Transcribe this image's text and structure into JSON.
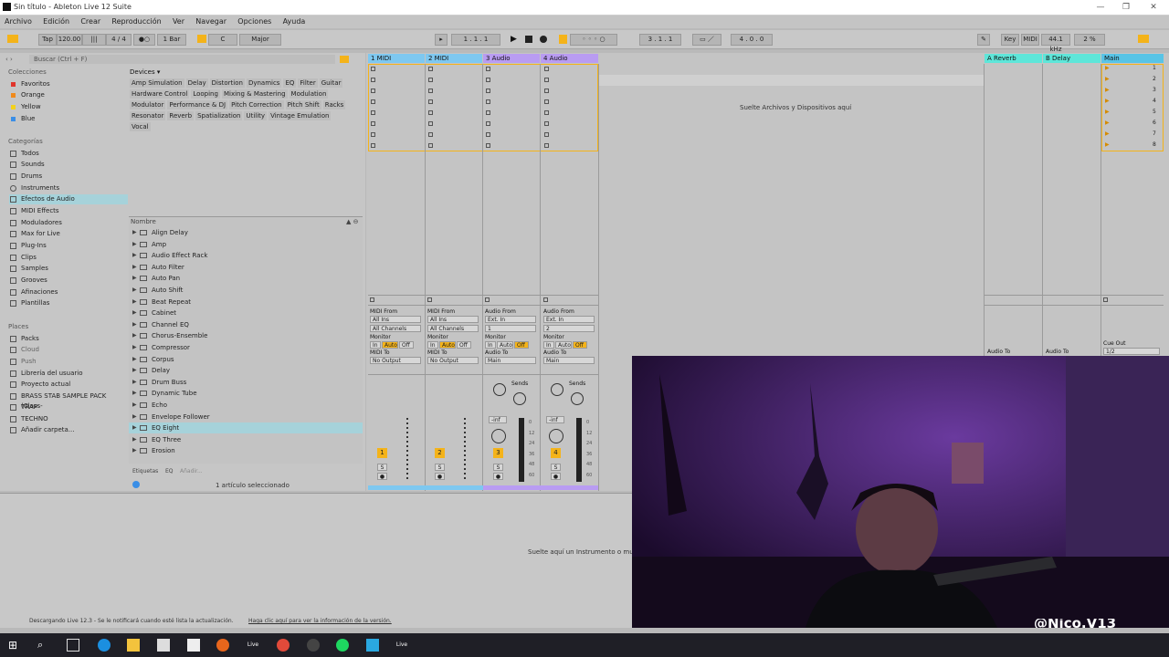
{
  "window": {
    "title": "Sin título - Ableton Live 12 Suite"
  },
  "menu": [
    "Archivo",
    "Edición",
    "Crear",
    "Reproducción",
    "Ver",
    "Navegar",
    "Opciones",
    "Ayuda"
  ],
  "control": {
    "tap": "Tap",
    "tempo": "120.00",
    "signature": "4 / 4",
    "quant": "1 Bar",
    "key": "C",
    "scale": "Major",
    "position": "1 . 1 . 1",
    "loop_start": "3 . 1 . 1",
    "loop_len": "4 . 0 . 0",
    "key_btn": "Key",
    "midi_btn": "MIDI",
    "sample_rate": "44.1 kHz",
    "cpu": "2 %"
  },
  "browser": {
    "search_placeholder": "Buscar (Ctrl + F)",
    "collections_head": "Colecciones",
    "collections": [
      {
        "label": "Favoritos",
        "color": "#e0342b"
      },
      {
        "label": "Orange",
        "color": "#f08a1c"
      },
      {
        "label": "Yellow",
        "color": "#f3d11c"
      },
      {
        "label": "Blue",
        "color": "#3a8ee6"
      }
    ],
    "categories_head": "Categorías",
    "categories": [
      "Todos",
      "Sounds",
      "Drums",
      "Instruments",
      "Efectos de Audio",
      "MIDI Effects",
      "Moduladores",
      "Max for Live",
      "Plug-Ins",
      "Clips",
      "Samples",
      "Grooves",
      "Afinaciones",
      "Plantillas"
    ],
    "places_head": "Places",
    "places": [
      "Packs",
      "Cloud",
      "Push",
      "Librería del usuario",
      "Proyecto actual",
      "BRASS STAB SAMPLE PACK (Class-",
      "TRAP",
      "TECHNO",
      "Añadir carpeta..."
    ],
    "devices_head": "Devices",
    "tags": [
      [
        "Amp Simulation",
        "Delay",
        "Distortion",
        "Dynamics",
        "EQ",
        "Filter",
        "Guitar"
      ],
      [
        "Hardware Control",
        "Looping",
        "Mixing & Mastering",
        "Modulation"
      ],
      [
        "Modulator",
        "Performance & DJ",
        "Pitch Correction",
        "Pitch Shift",
        "Racks"
      ],
      [
        "Resonator",
        "Reverb",
        "Spatialization",
        "Utility",
        "Vintage Emulation"
      ],
      [
        "Vocal"
      ]
    ],
    "list_head": "Nombre",
    "items": [
      "Align Delay",
      "Amp",
      "Audio Effect Rack",
      "Auto Filter",
      "Auto Pan",
      "Auto Shift",
      "Beat Repeat",
      "Cabinet",
      "Channel EQ",
      "Chorus-Ensemble",
      "Compressor",
      "Corpus",
      "Delay",
      "Drum Buss",
      "Dynamic Tube",
      "Echo",
      "Envelope Follower",
      "EQ Eight",
      "EQ Three",
      "Erosion"
    ],
    "selected_item": "EQ Eight",
    "tags_label": "Etiquetas",
    "tags_value": "EQ",
    "tags_add": "Añadir...",
    "status": "1 artículo seleccionado"
  },
  "session": {
    "tracks": [
      {
        "name": "1 MIDI",
        "color": "#7ec8f0",
        "num": "1"
      },
      {
        "name": "2 MIDI",
        "color": "#7ec8f0",
        "num": "2"
      },
      {
        "name": "3 Audio",
        "color": "#b99cf2",
        "num": "3"
      },
      {
        "name": "4 Audio",
        "color": "#b99cf2",
        "num": "4"
      }
    ],
    "returns": [
      {
        "name": "A Reverb",
        "color": "#5ee6d9"
      },
      {
        "name": "B Delay",
        "color": "#5ee6d9"
      }
    ],
    "main": {
      "name": "Main",
      "color": "#58c4e6"
    },
    "drop_text": "Suelte Archivos y Dispositivos aquí",
    "midi_from": "MIDI From",
    "all_ins": "All Ins",
    "all_channels": "All Channels",
    "audio_from": "Audio From",
    "ext_in": "Ext. In",
    "ch1": "1",
    "ch2": "2",
    "monitor": "Monitor",
    "in": "In",
    "auto": "Auto",
    "off": "Off",
    "midi_to": "MIDI To",
    "no_output": "No Output",
    "audio_to": "Audio To",
    "main_out": "Main",
    "sends": "Sends",
    "cue_out": "Cue Out",
    "cue_val": "1/2",
    "inf": "-inf",
    "scenes": [
      "1",
      "2",
      "3",
      "4",
      "5",
      "6",
      "7",
      "8"
    ],
    "meter_ticks": [
      "0",
      "12",
      "24",
      "36",
      "48",
      "60"
    ],
    "s": "S",
    "return_audio_to": "Audio To"
  },
  "detail": {
    "drop_text": "Suelte aquí un Instrumento o mues"
  },
  "statusbar": {
    "text": "Descargando Live 12.3 - Se le notificará cuando esté lista la actualización.",
    "link": "Haga clic aquí para ver la información de la versión."
  },
  "overlay": {
    "watermark": "@Nico.V13"
  },
  "taskbar": {
    "live_label": "Live"
  }
}
